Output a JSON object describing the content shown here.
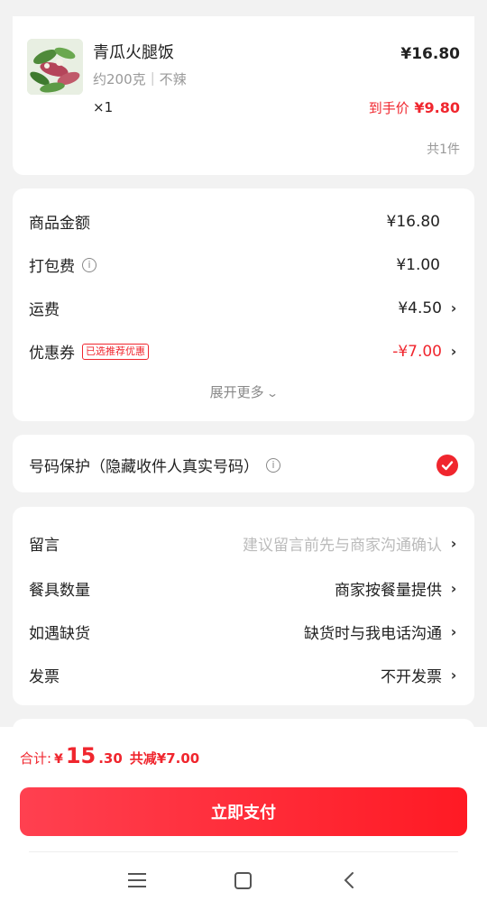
{
  "item": {
    "name": "青瓜火腿饭",
    "spec": "约200克｜不辣",
    "qty": "×1",
    "price": "¥16.80",
    "final_label": "到手价",
    "final_price": "¥9.80",
    "total_count": "共1件"
  },
  "fees": {
    "goods_label": "商品金额",
    "goods_value": "¥16.80",
    "pack_label": "打包费",
    "pack_value": "¥1.00",
    "ship_label": "运费",
    "ship_value": "¥4.50",
    "coupon_label": "优惠券",
    "coupon_tag": "已选推荐优惠",
    "coupon_value": "-¥7.00",
    "expand_label": "展开更多"
  },
  "privacy": {
    "label": "号码保护（隐藏收件人真实号码）",
    "checked": true
  },
  "options": {
    "remark_label": "留言",
    "remark_placeholder": "建议留言前先与商家沟通确认",
    "tableware_label": "餐具数量",
    "tableware_value": "商家按餐量提供",
    "stockout_label": "如遇缺货",
    "stockout_value": "缺货时与我电话沟通",
    "invoice_label": "发票",
    "invoice_value": "不开发票"
  },
  "footer": {
    "total_label": "合计:",
    "currency": "¥",
    "total_int": "15",
    "total_dec": ".30",
    "discount": "共减¥7.00",
    "pay_button": "立即支付"
  },
  "colors": {
    "accent": "#f0262e",
    "pay_gradient_start": "#ff4050",
    "pay_gradient_end": "#ff1a24"
  }
}
